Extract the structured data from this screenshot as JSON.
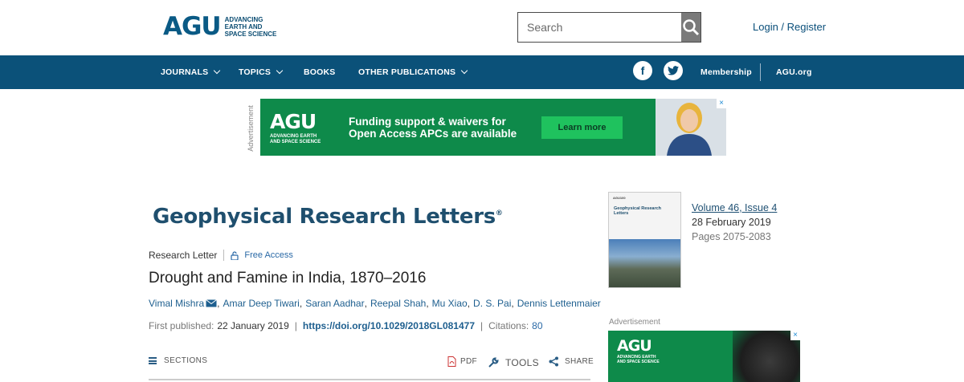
{
  "header": {
    "logo_text": "AGU",
    "logo_tagline": "ADVANCING EARTH AND SPACE SCIENCE",
    "search_placeholder": "Search",
    "login_label": "Login / Register"
  },
  "nav": {
    "items": [
      {
        "label": "JOURNALS",
        "has_dropdown": true
      },
      {
        "label": "TOPICS",
        "has_dropdown": true
      },
      {
        "label": "BOOKS",
        "has_dropdown": false
      },
      {
        "label": "OTHER PUBLICATIONS",
        "has_dropdown": true
      }
    ],
    "social": [
      "facebook-icon",
      "twitter-icon"
    ],
    "membership_label": "Membership",
    "agu_org_label": "AGU.org"
  },
  "ad_top": {
    "label": "Advertisement",
    "logo_text": "AGU",
    "logo_tagline": "ADVANCING EARTH AND SPACE SCIENCE",
    "headline": "Funding support & waivers for Open Access APCs are available",
    "cta": "Learn more",
    "close": "×"
  },
  "journal": {
    "title": "Geophysical Research Letters",
    "mark": "®"
  },
  "article": {
    "type": "Research Letter",
    "access": "Free Access",
    "title": "Drought and Famine in India, 1870–2016",
    "authors": [
      "Vimal Mishra",
      "Amar Deep Tiwari",
      "Saran Aadhar",
      "Reepal Shah",
      "Mu Xiao",
      "D. S. Pai",
      "Dennis Lettenmaier"
    ],
    "first_published_label": "First published:",
    "first_published_date": "22 January 2019",
    "doi": "https://doi.org/10.1029/2018GL081477",
    "citations_label": "Citations:",
    "citations_count": "80"
  },
  "toolbar": {
    "sections_label": "SECTIONS",
    "pdf_label": "PDF",
    "tools_label": "TOOLS",
    "share_label": "SHARE"
  },
  "issue": {
    "volume_label": "Volume",
    "volume": "46",
    "issue_label": "Issue",
    "issue": "4",
    "date": "28 February 2019",
    "pages": "Pages 2075-2083",
    "cover_title": "Geophysical Research Letters"
  },
  "ad_side": {
    "label": "Advertisement",
    "logo_text": "AGU",
    "logo_tagline": "ADVANCING EARTH AND SPACE SCIENCE",
    "close": "×"
  },
  "colors": {
    "nav_bg": "#0b5179",
    "ad_green": "#0e8a4a",
    "link_blue": "#1e5f8f"
  }
}
